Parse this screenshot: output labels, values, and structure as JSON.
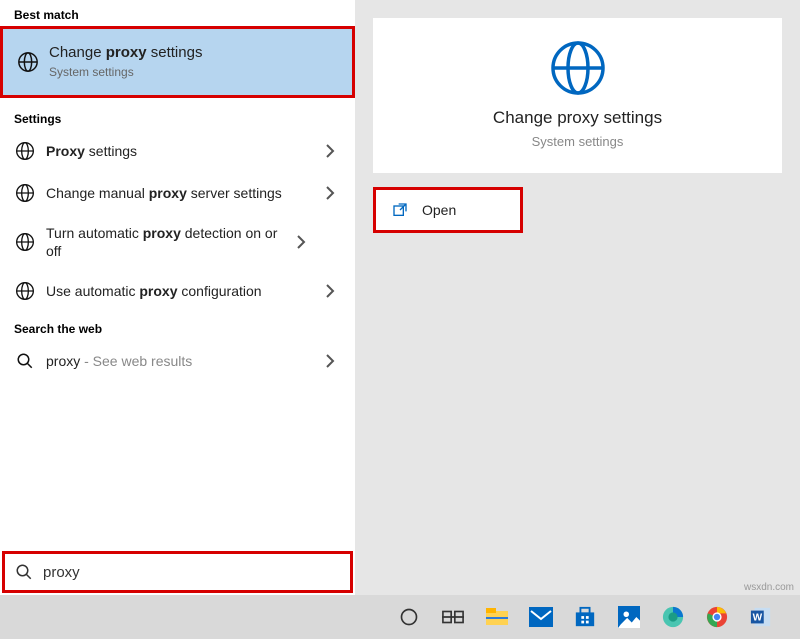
{
  "left": {
    "best_match_header": "Best match",
    "best": {
      "title_pre": "Change ",
      "title_bold": "proxy",
      "title_post": " settings",
      "subtitle": "System settings"
    },
    "settings_header": "Settings",
    "items": [
      {
        "pre": "",
        "bold": "Proxy",
        "post": " settings"
      },
      {
        "pre": "Change manual ",
        "bold": "proxy",
        "post": " server settings"
      },
      {
        "pre": "Turn automatic ",
        "bold": "proxy",
        "post": " detection on or off"
      },
      {
        "pre": "Use automatic ",
        "bold": "proxy",
        "post": " configuration"
      }
    ],
    "web_header": "Search the web",
    "web": {
      "text": "proxy",
      "hint": " - See web results"
    }
  },
  "right": {
    "title": "Change proxy settings",
    "subtitle": "System settings",
    "open_label": "Open"
  },
  "search": {
    "value": "proxy"
  },
  "watermark": "wsxdn.com"
}
